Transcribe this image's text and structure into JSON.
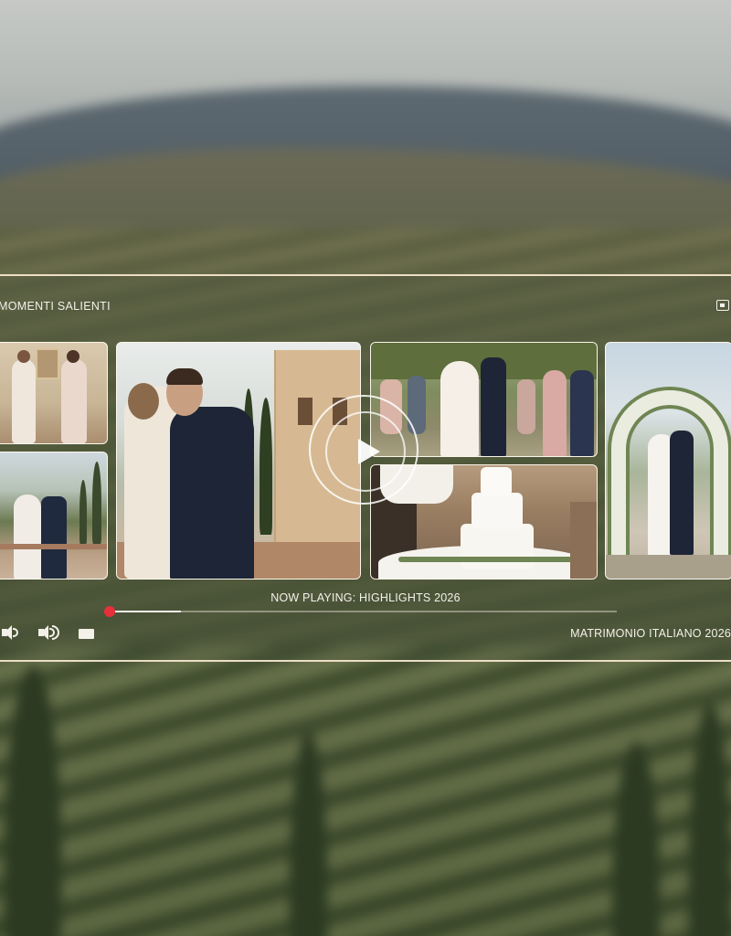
{
  "player": {
    "title": "MOMENTI SALIENTI",
    "now_playing": "NOW PLAYING: HIGHLIGHTS 2026",
    "brand": "MATRIMONIO ITALIANO 2026",
    "progress": 0.14,
    "accent_color": "#e8303a"
  },
  "icons": {
    "cast": "cast-icon",
    "play": "play-icon",
    "volume_down": "volume-low-icon",
    "volume_up": "volume-high-icon",
    "fullscreen": "fullscreen-icon"
  },
  "gallery": [
    {
      "scene": "bridal-prep"
    },
    {
      "scene": "couple-kiss-cypress"
    },
    {
      "scene": "couple-kiss-terrace"
    },
    {
      "scene": "ceremony-guests"
    },
    {
      "scene": "cake-cutting"
    },
    {
      "scene": "floral-arch"
    }
  ]
}
